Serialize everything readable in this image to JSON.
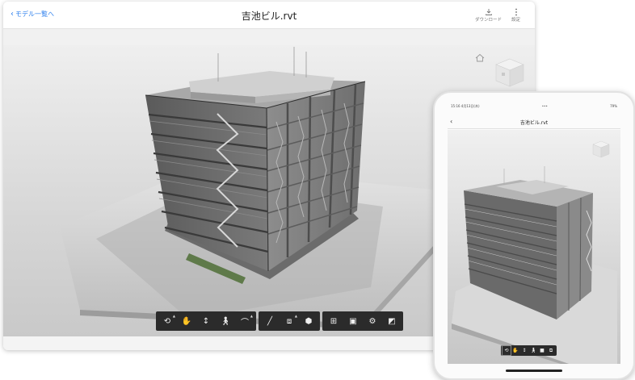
{
  "tablet": {
    "back_label": "モデル一覧へ",
    "title": "吉池ビル.rvt",
    "download_label": "ダウンロード",
    "settings_label": "設定"
  },
  "phone": {
    "status_time": "15:16  4月13日(木)",
    "status_dots": "•••",
    "status_battery": "79%",
    "title": "吉池ビル.rvt"
  },
  "colors": {
    "accent": "#2f80ed",
    "toolbar_bg": "#2b2b2b",
    "active_tool": "#3b8cff"
  },
  "toolbar_icons": [
    "orbit-icon",
    "pan-icon",
    "zoom-icon",
    "walk-icon",
    "camera-icon",
    "measure-icon",
    "section-icon",
    "explode-icon",
    "model-browser-icon",
    "properties-icon",
    "settings-icon",
    "fullscreen-icon"
  ],
  "active_tool": "pan-icon"
}
